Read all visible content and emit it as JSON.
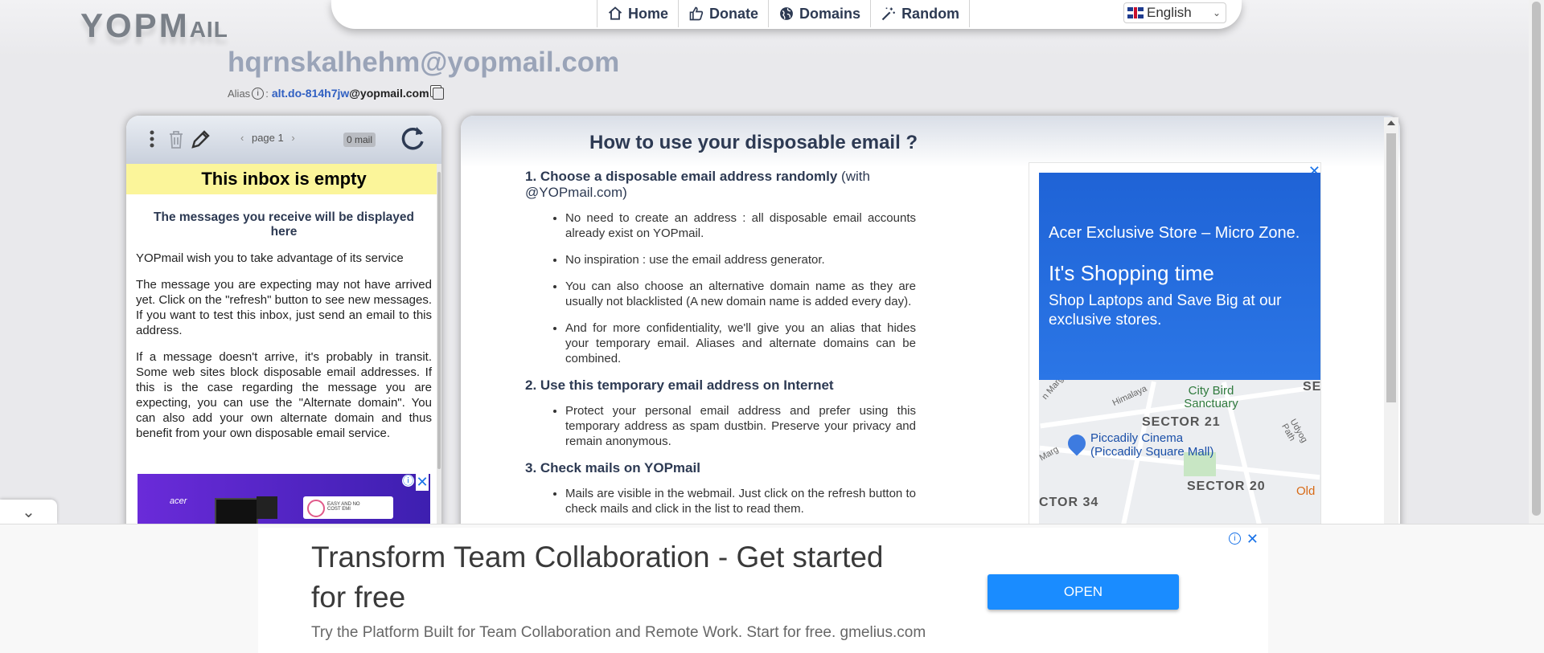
{
  "logo": {
    "main": "YOPM",
    "tail": "AIL"
  },
  "nav": {
    "items": [
      {
        "label": "Home",
        "icon": "home-icon"
      },
      {
        "label": "Donate",
        "icon": "thumbs-up-icon"
      },
      {
        "label": "Domains",
        "icon": "globe-icon"
      },
      {
        "label": "Random",
        "icon": "magic-wand-icon"
      }
    ],
    "language": "English"
  },
  "account": {
    "email": "hqrnskalhehm@yopmail.com",
    "alias_label": "Alias",
    "alias_value": "alt.do-814h7jw",
    "alias_domain": "@yopmail.com"
  },
  "inbox": {
    "page_label": "page 1",
    "mail_count": "0 mail",
    "empty_title": "This inbox is empty",
    "subtitle": "The messages you receive will be displayed here",
    "paragraphs": [
      "YOPmail wish you to take advantage of its service",
      "The message you are expecting may not have arrived yet. Click on the \"refresh\" button to see new messages. If you want to test this inbox, just send an email to this address.",
      "If a message doesn't arrive, it's probably in transit. Some web sites block disposable email addresses. If this is the case regarding the message you are expecting, you can use the \"Alternate domain\". You can also add your own alternate domain and thus benefit from your own disposable email service."
    ],
    "ad": {
      "brand": "acer",
      "card_text": "EASY AND NO COST EMI"
    }
  },
  "main": {
    "title": "How to use your disposable email ?",
    "steps": [
      {
        "title": "1. Choose a disposable email address randomly",
        "extra": "(with @YOPmail.com)",
        "bullets": [
          "No need to create an address : all disposable email accounts already exist on YOPmail.",
          "No inspiration : use the email address generator.",
          "You can also choose an alternative domain name as they are usually not blacklisted (A new domain name is added every day).",
          "And for more confidentiality, we'll give you an alias that hides your temporary email. Aliases and alternate domains can be combined."
        ]
      },
      {
        "title": "2. Use this temporary email address on Internet",
        "extra": "",
        "bullets": [
          "Protect your personal email address and prefer using this temporary address as spam dustbin. Preserve your privacy and remain anonymous."
        ]
      },
      {
        "title": "3. Check mails on YOPmail",
        "extra": "",
        "bullets": [
          "Mails are visible in the webmail. Just click on the refresh button to check mails and click in the list to read them."
        ]
      }
    ]
  },
  "side_ad": {
    "line1": "Acer Exclusive Store – Micro Zone.",
    "line2": "It's Shopping time",
    "line3": "Shop Laptops and Save Big at our exclusive stores.",
    "map": {
      "labels": [
        "City Bird Sanctuary",
        "SECTOR 21",
        "Piccadily Cinema (Piccadily Square Mall)",
        "SECTOR 20",
        "CTOR 34",
        "Old",
        "SE",
        "Himalaya",
        "Udyog Path",
        "n Marg",
        "Marg"
      ]
    }
  },
  "bottom_ad": {
    "headline": "Transform Team Collaboration - Get started for free",
    "subline": "Try the Platform Built for Team Collaboration and Remote Work. Start for free. gmelius.com",
    "button": "OPEN"
  }
}
